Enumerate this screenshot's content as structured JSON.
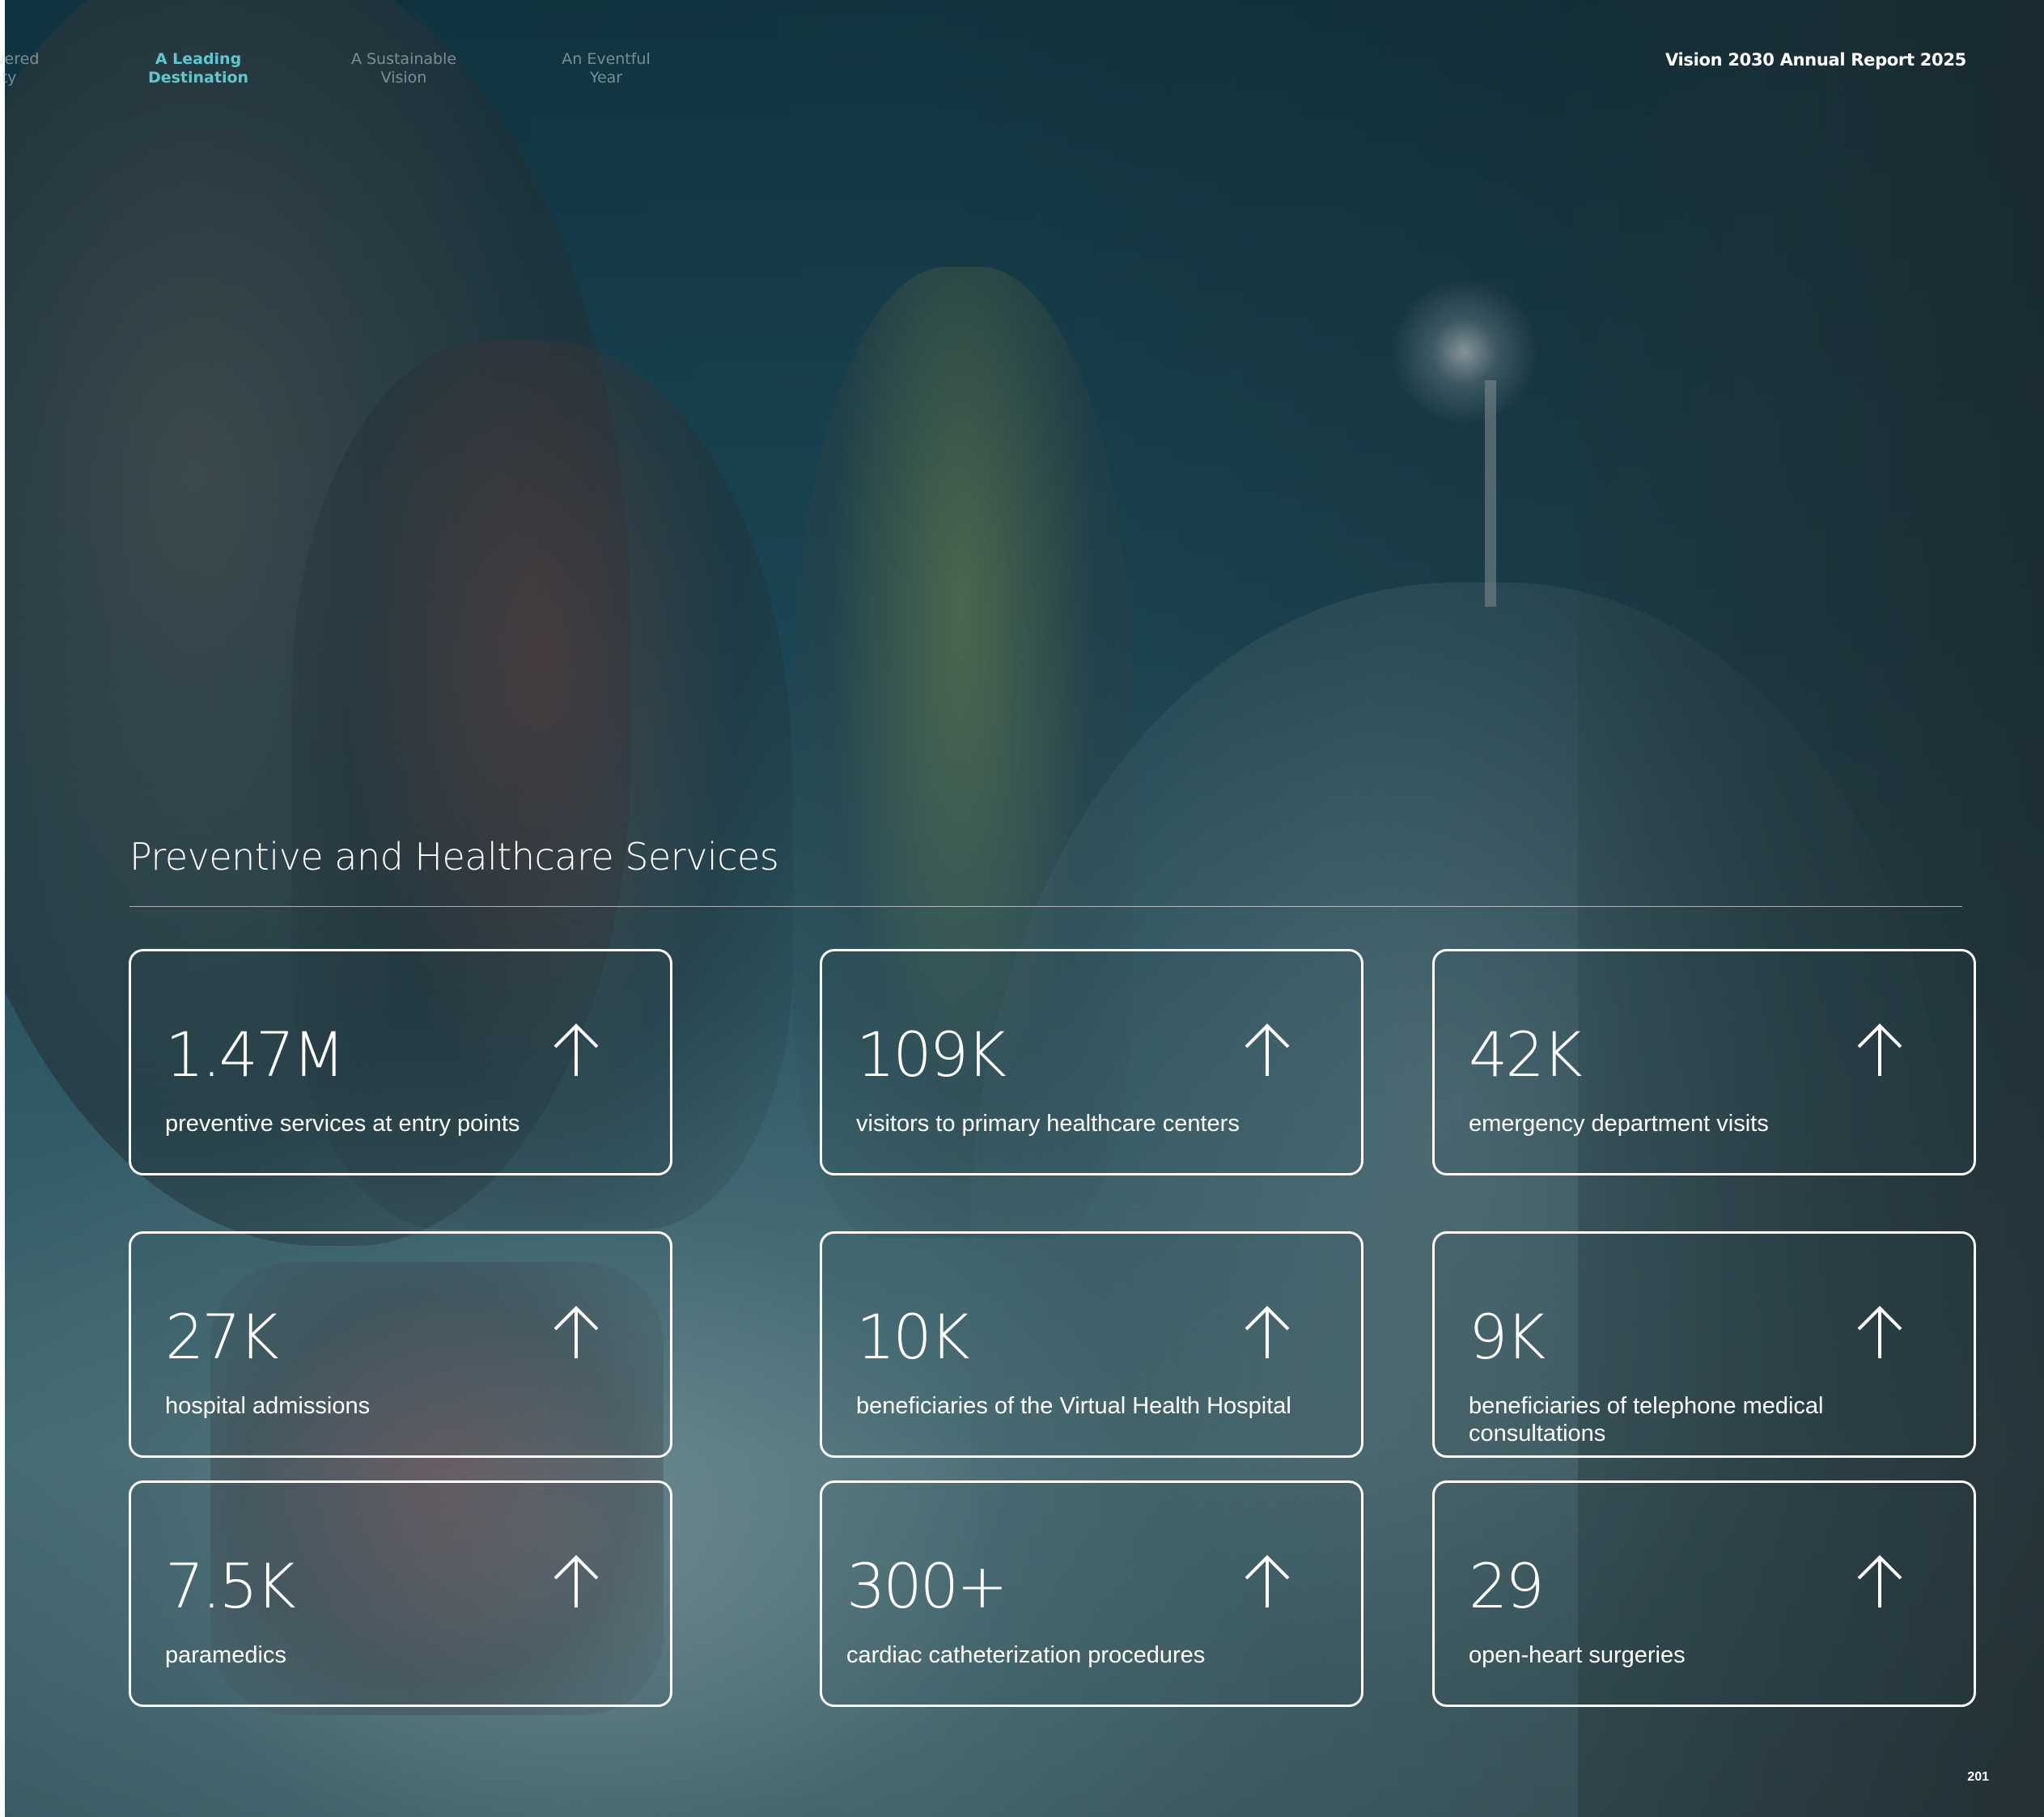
{
  "nav": {
    "items": [
      {
        "label": "wered\nety",
        "active": false
      },
      {
        "label": "A Leading\nDestination",
        "active": true
      },
      {
        "label": "A Sustainable\nVision",
        "active": false
      },
      {
        "label": "An Eventful\nYear",
        "active": false
      }
    ]
  },
  "report_title": "Vision 2030 Annual Report 2025",
  "section": {
    "title": "Preventive and Healthcare Services"
  },
  "stats": [
    {
      "value": "1.47M",
      "label": "preventive services at entry points"
    },
    {
      "value": "109K",
      "label": "visitors to primary healthcare centers"
    },
    {
      "value": "42K",
      "label": "emergency department visits"
    },
    {
      "value": "27K",
      "label": "hospital admissions"
    },
    {
      "value": "10K",
      "label": "beneficiaries of the Virtual Health Hospital"
    },
    {
      "value": "9K",
      "label": "beneficiaries of telephone medical consultations"
    },
    {
      "value": "7.5K",
      "label": "paramedics"
    },
    {
      "value": "300+",
      "label": "cardiac catheterization procedures"
    },
    {
      "value": "29",
      "label": "open-heart surgeries"
    }
  ],
  "page_number": "201",
  "colors": {
    "accent": "#63c6cf",
    "text": "#ffffff"
  },
  "icons": {
    "stat_icon": "arrow-up-icon"
  }
}
